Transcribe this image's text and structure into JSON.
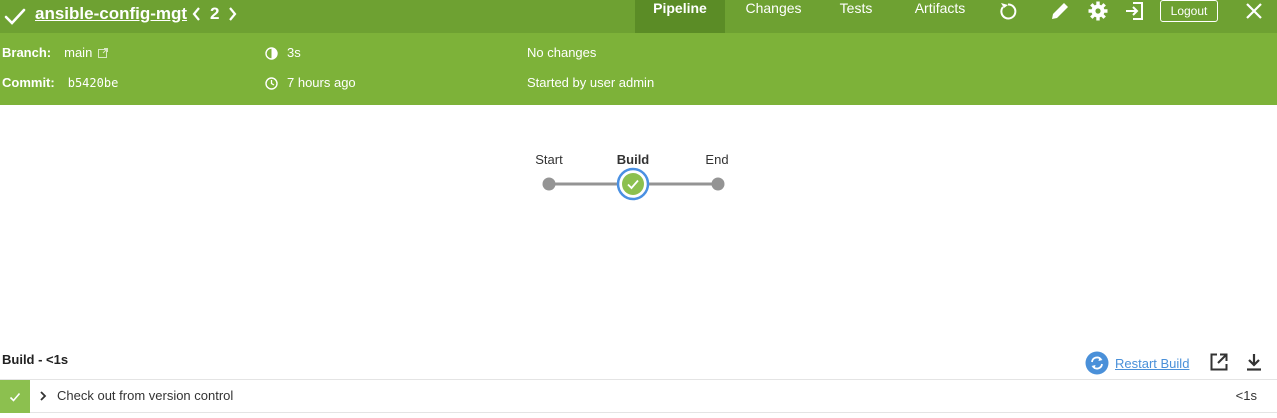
{
  "header": {
    "run_name": "ansible-config-mgt",
    "run_number": "2",
    "tabs": [
      "Pipeline",
      "Changes",
      "Tests",
      "Artifacts"
    ],
    "logout_label": "Logout",
    "colors": {
      "bar": "#6ea132",
      "active_tab": "#5b8c26",
      "info": "#7db239"
    }
  },
  "info": {
    "branch_label": "Branch:",
    "branch_value": "main",
    "commit_label": "Commit:",
    "commit_value": "b5420be",
    "duration": "3s",
    "time_ago": "7 hours ago",
    "changes": "No changes",
    "started_by": "Started by user admin"
  },
  "graph": {
    "stages": [
      {
        "label": "Start",
        "state": "start"
      },
      {
        "label": "Build",
        "state": "success"
      },
      {
        "label": "End",
        "state": "end"
      }
    ]
  },
  "steps": {
    "title": "Build - <1s",
    "restart_label": "Restart Build",
    "items": [
      {
        "name": "Check out from version control",
        "duration": "<1s",
        "status": "success"
      }
    ]
  }
}
